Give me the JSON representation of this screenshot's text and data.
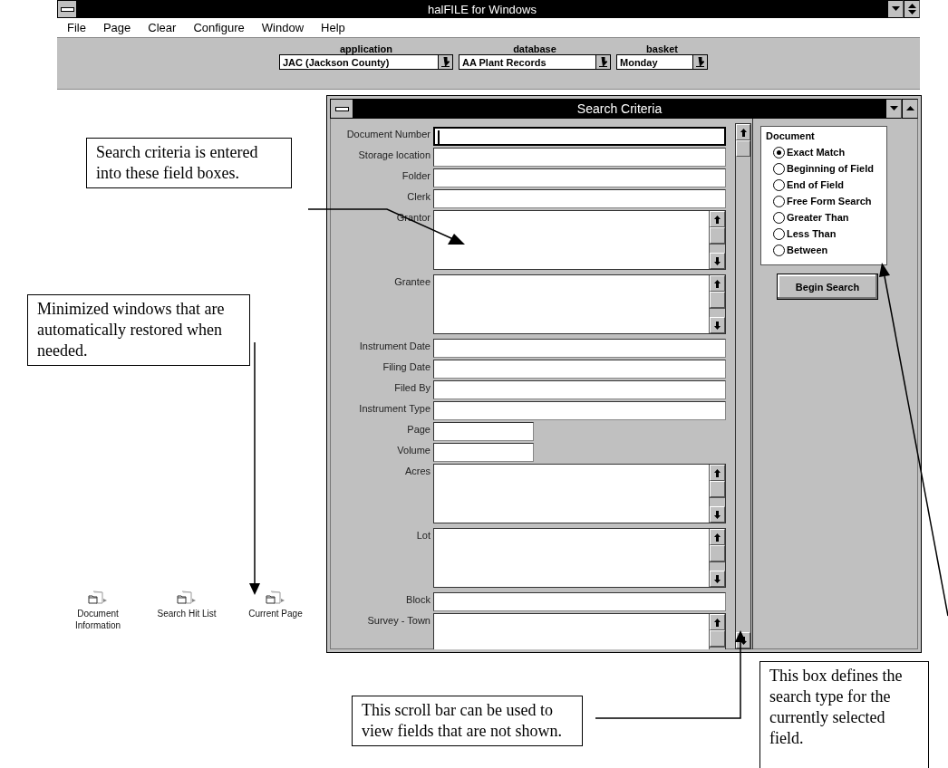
{
  "app": {
    "title": "halFILE for Windows",
    "menu": [
      {
        "label": "File"
      },
      {
        "label": "Page"
      },
      {
        "label": "Clear"
      },
      {
        "label": "Configure"
      },
      {
        "label": "Window"
      },
      {
        "label": "Help"
      }
    ],
    "selectors": [
      {
        "label": "application",
        "value": "JAC  (Jackson County)"
      },
      {
        "label": "database",
        "value": "AA Plant Records"
      },
      {
        "label": "basket",
        "value": "Monday"
      }
    ]
  },
  "search_window": {
    "title": "Search Criteria",
    "fields": [
      {
        "label": "Document Number",
        "kind": "line",
        "focused": true
      },
      {
        "label": "Storage location",
        "kind": "line",
        "focused": false
      },
      {
        "label": "Folder",
        "kind": "line",
        "focused": false
      },
      {
        "label": "Clerk",
        "kind": "line",
        "focused": false
      },
      {
        "label": "Grantor",
        "kind": "area",
        "focused": false
      },
      {
        "label": "Grantee",
        "kind": "area",
        "focused": false
      },
      {
        "label": "Instrument Date",
        "kind": "line",
        "focused": false
      },
      {
        "label": "Filing Date",
        "kind": "line",
        "focused": false
      },
      {
        "label": "Filed By",
        "kind": "line",
        "focused": false
      },
      {
        "label": "Instrument Type",
        "kind": "line",
        "focused": false
      },
      {
        "label": "Page",
        "kind": "short",
        "focused": false
      },
      {
        "label": "Volume",
        "kind": "short",
        "focused": false
      },
      {
        "label": "Acres",
        "kind": "area",
        "focused": false
      },
      {
        "label": "Lot",
        "kind": "area",
        "focused": false
      },
      {
        "label": "Block",
        "kind": "line",
        "focused": false
      },
      {
        "label": "Survey - Town",
        "kind": "area",
        "focused": false
      }
    ],
    "match_group": {
      "title": "Document",
      "options": [
        {
          "label": "Exact Match",
          "selected": true
        },
        {
          "label": "Beginning of Field",
          "selected": false
        },
        {
          "label": "End of Field",
          "selected": false
        },
        {
          "label": "Free Form Search",
          "selected": false
        },
        {
          "label": "Greater Than",
          "selected": false
        },
        {
          "label": "Less Than",
          "selected": false
        },
        {
          "label": "Between",
          "selected": false
        }
      ]
    },
    "button": {
      "label": "Begin Search"
    }
  },
  "minimized_windows": [
    {
      "label": "Document Information"
    },
    {
      "label": "Search Hit List"
    },
    {
      "label": "Current Page"
    }
  ],
  "callouts": [
    {
      "text": "Search criteria is entered into these field boxes.",
      "kind": "fields"
    },
    {
      "text": "Minimized windows that are automatically restored when needed.",
      "kind": "minimized"
    },
    {
      "text": "This scroll bar can be used to view fields that are not shown.",
      "kind": "scrollbar"
    },
    {
      "text": "This box defines the search type for the currently selected field.",
      "kind": "searchtype"
    }
  ]
}
